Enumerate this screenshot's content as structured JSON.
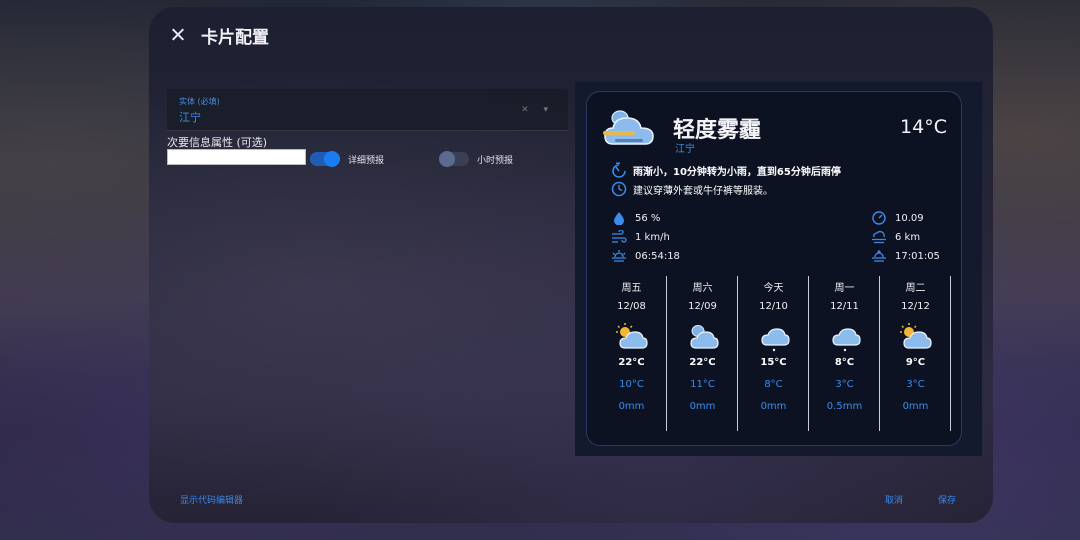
{
  "dialog": {
    "title": "卡片配置",
    "show_code_editor": "显示代码编辑器",
    "cancel": "取消",
    "save": "保存"
  },
  "editor": {
    "entity_label": "实体 (必填)",
    "entity_value": "江宁",
    "secondary_label": "次要信息属性 (可选)",
    "secondary_value": "",
    "detailed_forecast_label": "详细预报",
    "detailed_forecast_on": true,
    "hourly_forecast_label": "小时预报",
    "hourly_forecast_on": false
  },
  "weather": {
    "condition": "轻度雾霾",
    "location": "江宁",
    "temperature": "14°C",
    "alert_precip": "雨渐小，10分钟转为小雨，直到65分钟后雨停",
    "alert_advice": "建议穿薄外套或牛仔裤等服装。",
    "humidity": "56 %",
    "wind": "1 km/h",
    "sunrise": "06:54:18",
    "pressure": "10.09",
    "visibility": "6 km",
    "sunset": "17:01:05",
    "icons": {
      "condition": "cloudy-haze-icon",
      "humidity": "water-drop-icon",
      "wind": "wind-icon",
      "sunrise": "sunrise-icon",
      "pressure": "gauge-icon",
      "visibility": "fog-icon",
      "sunset": "sunset-icon"
    }
  },
  "forecast": [
    {
      "day": "周五",
      "date": "12/08",
      "icon": "partly-cloudy-icon",
      "high": "22°C",
      "low": "10°C",
      "precip": "0mm"
    },
    {
      "day": "周六",
      "date": "12/09",
      "icon": "cloudy-icon",
      "high": "22°C",
      "low": "11°C",
      "precip": "0mm"
    },
    {
      "day": "今天",
      "date": "12/10",
      "icon": "light-rain-icon",
      "high": "15°C",
      "low": "8°C",
      "precip": "0mm"
    },
    {
      "day": "周一",
      "date": "12/11",
      "icon": "light-rain-icon",
      "high": "8°C",
      "low": "3°C",
      "precip": "0.5mm"
    },
    {
      "day": "周二",
      "date": "12/12",
      "icon": "partly-cloudy-icon",
      "high": "9°C",
      "low": "3°C",
      "precip": "0mm"
    }
  ],
  "colors": {
    "accent": "#3d8ce8",
    "card_bg": "#0d1222",
    "dialog_bg": "#1f2232"
  }
}
